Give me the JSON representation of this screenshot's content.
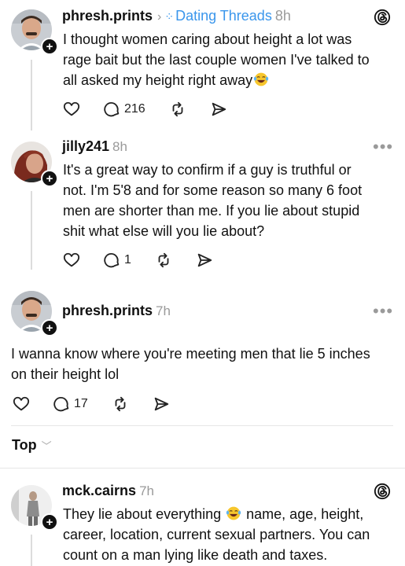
{
  "posts": [
    {
      "username": "phresh.prints",
      "thread_name": "Dating Threads",
      "time": "8h",
      "lines": [
        "I thought women caring about height a lot was",
        "rage bait but the last couple women I've talked to",
        "all asked my height right away"
      ],
      "emoji": "laughing-tears",
      "replies": "216"
    },
    {
      "username": "jilly241",
      "time": "8h",
      "lines": [
        "It's a great way to confirm if a guy is truthful or",
        "not. I'm 5'8 and for some reason so many 6 foot",
        "men are shorter than me. If you lie about stupid",
        "shit what else will you lie about?"
      ],
      "replies": "1"
    },
    {
      "username": "phresh.prints",
      "time": "7h",
      "lines": [
        "I wanna know where you're meeting men that lie 5 inches",
        "on their height lol"
      ],
      "replies": "17"
    },
    {
      "username": "mck.cairns",
      "time": "7h",
      "lines": [
        "They lie about everything",
        "name, age, height,",
        "career, location, current sexual partners. You can",
        "count on a man lying like death and taxes."
      ]
    }
  ],
  "sort": {
    "label": "Top"
  },
  "colors": {
    "accent": "#3a96ec",
    "muted": "#9a9a9a",
    "text": "#111111"
  },
  "icons": [
    "plus-icon",
    "chevron-right-icon",
    "threads-logo-icon",
    "more-icon",
    "heart-icon",
    "reply-icon",
    "repost-icon",
    "share-icon",
    "chevron-down-icon",
    "laughing-tears-emoji"
  ]
}
